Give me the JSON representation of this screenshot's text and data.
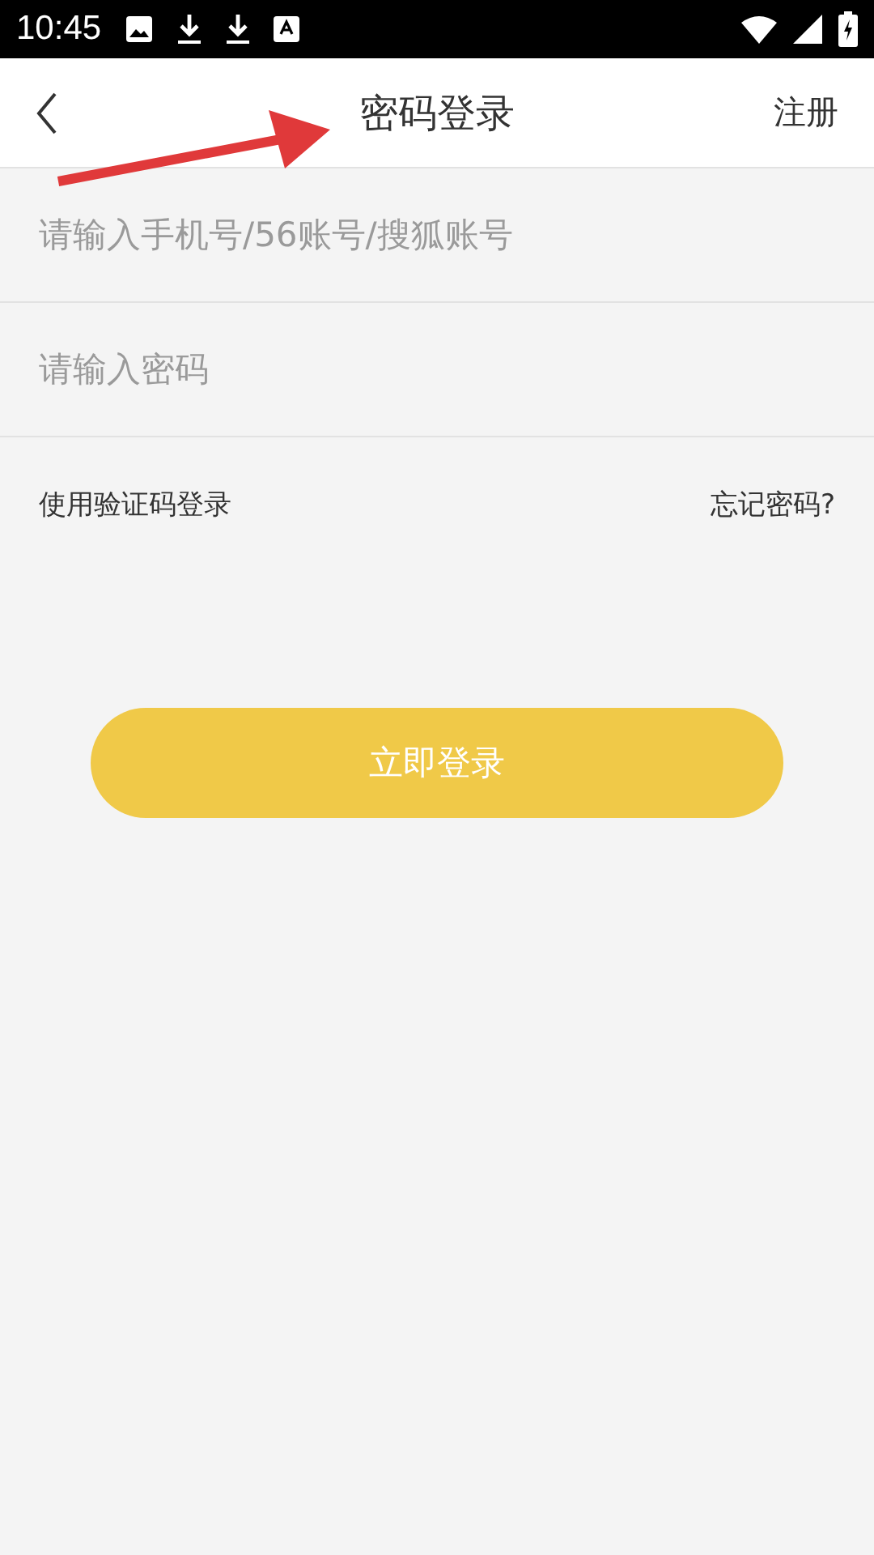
{
  "status_bar": {
    "time": "10:45"
  },
  "header": {
    "title": "密码登录",
    "action": "注册"
  },
  "fields": [
    {
      "placeholder": "请输入手机号/56账号/搜狐账号"
    },
    {
      "placeholder": "请输入密码"
    }
  ],
  "links": {
    "left": "使用验证码登录",
    "right": "忘记密码?"
  },
  "login_button": {
    "label": "立即登录",
    "disabled": true
  }
}
